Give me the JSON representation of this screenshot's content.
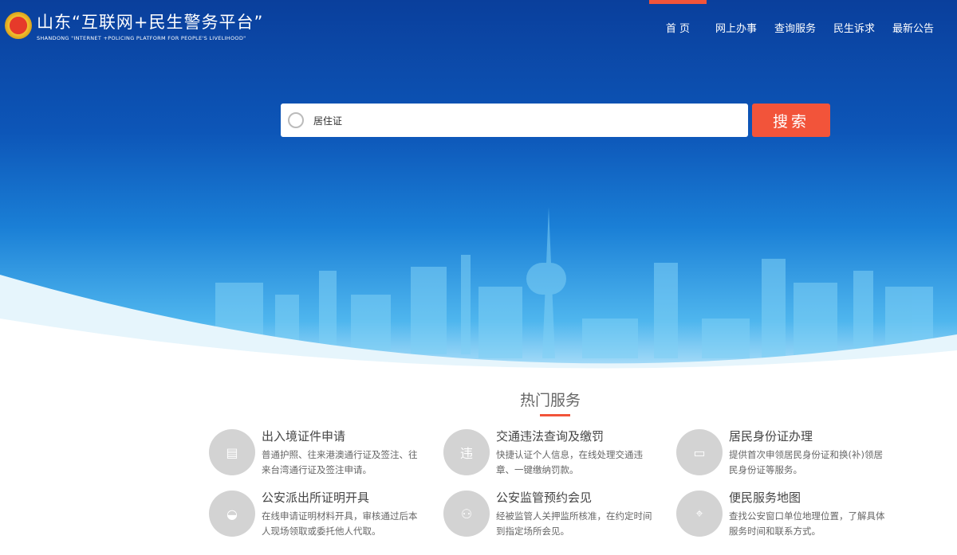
{
  "header": {
    "title": "山东“互联网+民生警务平台”",
    "subtitle": "SHANDONG \"INTERNET +POLICING PLATFORM FOR PEOPLE'S LIVELIHOOD\""
  },
  "nav": [
    "首 页",
    "网上办事",
    "查询服务",
    "民生诉求",
    "最新公告"
  ],
  "search": {
    "value": "居住证",
    "button": "搜索"
  },
  "section_title": "热门服务",
  "services": [
    {
      "title": "出入境证件申请",
      "desc": "普通护照、往来港澳通行证及签注、往来台湾通行证及签注申请。",
      "icon": "passport-icon",
      "glyph": "▤"
    },
    {
      "title": "交通违法查询及缴罚",
      "desc": "快捷认证个人信息，在线处理交通违章、一键缴纳罚款。",
      "icon": "traffic-violation-icon",
      "glyph": "违"
    },
    {
      "title": "居民身份证办理",
      "desc": "提供首次申领居民身份证和换(补)领居民身份证等服务。",
      "icon": "id-card-icon",
      "glyph": "▭"
    },
    {
      "title": "公安派出所证明开具",
      "desc": "在线申请证明材料开具，审核通过后本人现场领取或委托他人代取。",
      "icon": "police-cap-icon",
      "glyph": "◒"
    },
    {
      "title": "公安监管预约会见",
      "desc": "经被监管人关押监所核准，在约定时间到指定场所会见。",
      "icon": "people-icon",
      "glyph": "⚇"
    },
    {
      "title": "便民服务地图",
      "desc": "查找公安窗口单位地理位置，了解具体服务时间和联系方式。",
      "icon": "map-pin-icon",
      "glyph": "⌖"
    }
  ]
}
